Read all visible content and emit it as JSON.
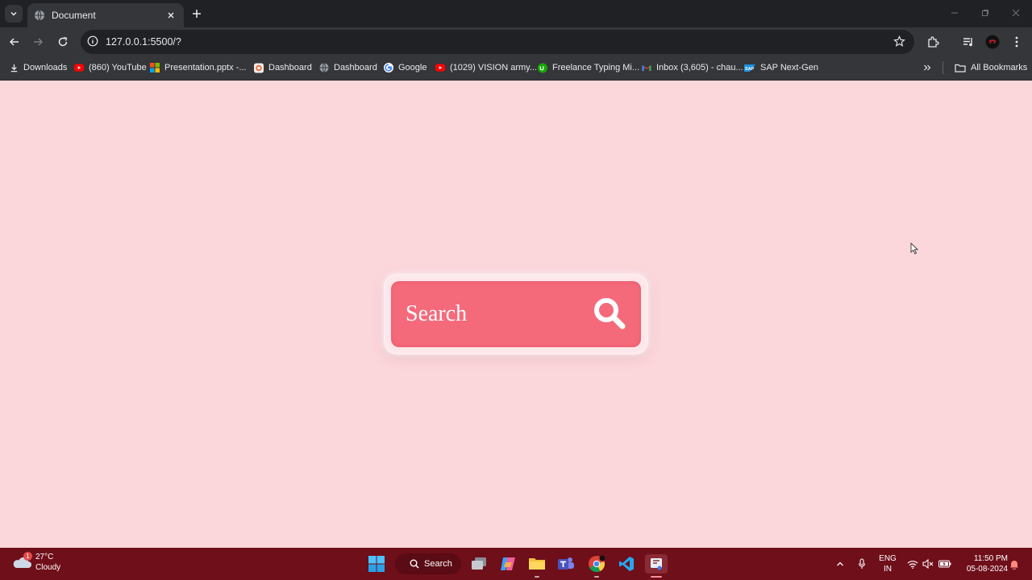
{
  "browser": {
    "tab": {
      "title": "Document"
    },
    "address": {
      "url": "127.0.0.1:5500/?"
    },
    "bookmarks": [
      {
        "label": "Downloads",
        "icon": "download-icon"
      },
      {
        "label": "(860) YouTube",
        "icon": "youtube-icon"
      },
      {
        "label": "Presentation.pptx -...",
        "icon": "microsoft-icon"
      },
      {
        "label": "Dashboard",
        "icon": "dashboard-icon"
      },
      {
        "label": "Dashboard",
        "icon": "globe-icon"
      },
      {
        "label": "Google",
        "icon": "google-icon"
      },
      {
        "label": "(1029) VISION army...",
        "icon": "youtube-icon"
      },
      {
        "label": "Freelance Typing Mi...",
        "icon": "upwork-icon"
      },
      {
        "label": "Inbox (3,605) - chau...",
        "icon": "gmail-icon"
      },
      {
        "label": "SAP Next-Gen",
        "icon": "sap-icon"
      }
    ],
    "all_bookmarks": "All Bookmarks"
  },
  "page": {
    "search_label": "Search",
    "colors": {
      "background": "#fbd6db",
      "search_box": "#f56a7b",
      "text": "#ffffff"
    }
  },
  "taskbar": {
    "weather": {
      "temp": "27°C",
      "condition": "Cloudy",
      "badge": "1"
    },
    "search_label": "Search",
    "lang": {
      "line1": "ENG",
      "line2": "IN"
    },
    "clock": {
      "time": "11:50 PM",
      "date": "05-08-2024"
    },
    "color": "#6e0f1a"
  }
}
